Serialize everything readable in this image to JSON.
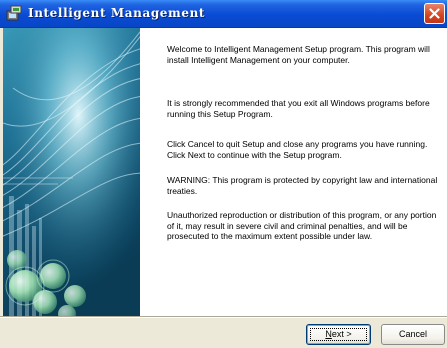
{
  "window": {
    "title": "Intelligent Management",
    "icon": "setup-installer-icon"
  },
  "content": {
    "welcome": "Welcome to  Intelligent Management Setup program. This program will install  Intelligent Management on your computer.",
    "recommend": "It is strongly recommended that you exit all Windows programs before running this Setup Program.",
    "instructions": "Click Cancel to quit Setup and close any programs you have running.  Click Next to continue with the Setup program.",
    "warning": "WARNING: This program is protected by copyright law and international treaties.",
    "legal": "Unauthorized reproduction or distribution of this program, or any portion of it, may result in severe civil and criminal penalties, and will be prosecuted to the maximum extent possible under law."
  },
  "buttons": {
    "next_prefix": "",
    "next_mnemonic": "N",
    "next_suffix": "ext >",
    "cancel": "Cancel"
  },
  "colors": {
    "titlebar": "#0a4bd4",
    "side_panel": "#1b6f8e",
    "close": "#d4451f"
  }
}
